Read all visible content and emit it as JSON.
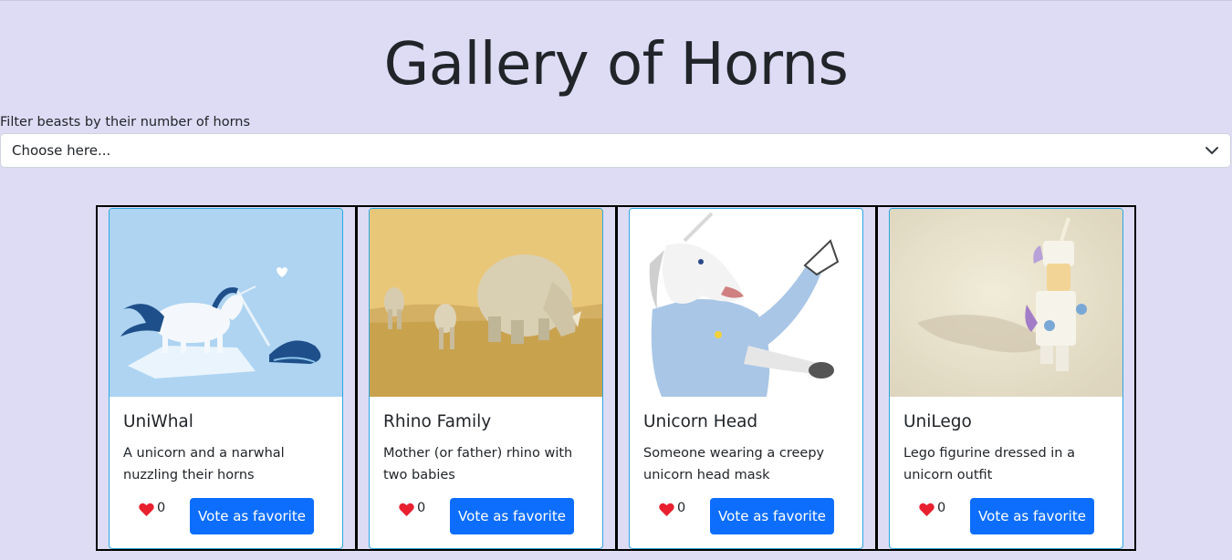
{
  "page": {
    "title": "Gallery of Horns"
  },
  "filter": {
    "label": "Filter beasts by their number of horns",
    "selected": "Choose here..."
  },
  "cards": [
    {
      "name": "UniWhal",
      "description": "A unicorn and a narwhal nuzzling their horns",
      "votes": "0",
      "vote_label": "Vote as favorite"
    },
    {
      "name": "Rhino Family",
      "description": "Mother (or father) rhino with two babies",
      "votes": "0",
      "vote_label": "Vote as favorite"
    },
    {
      "name": "Unicorn Head",
      "description": "Someone wearing a creepy unicorn head mask",
      "votes": "0",
      "vote_label": "Vote as favorite"
    },
    {
      "name": "UniLego",
      "description": "Lego figurine dressed in a unicorn outfit",
      "votes": "0",
      "vote_label": "Vote as favorite"
    }
  ],
  "colors": {
    "background": "#dedcf5",
    "accent": "#0d6efd",
    "heart": "#e8202f",
    "card_border": "#2aa8e0"
  }
}
